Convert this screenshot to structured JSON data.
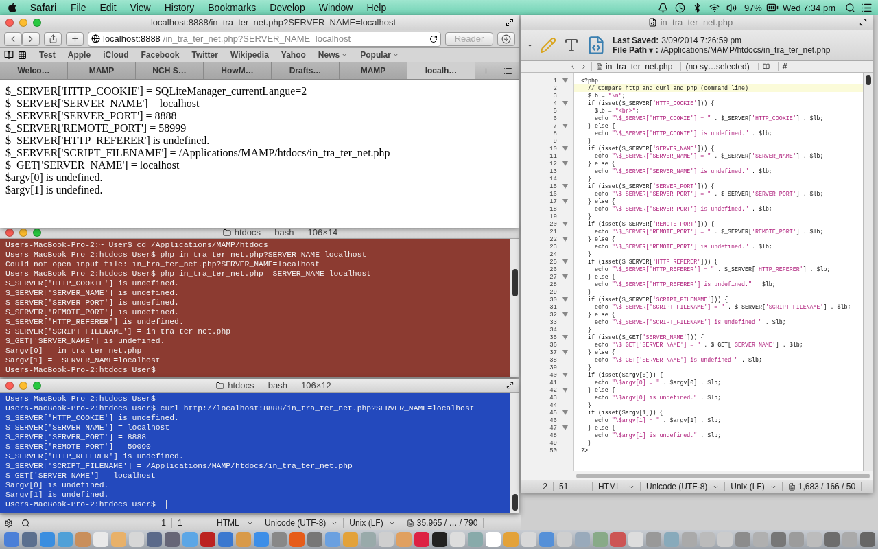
{
  "menubar": {
    "app": "Safari",
    "menus": [
      "File",
      "Edit",
      "View",
      "History",
      "Bookmarks",
      "Develop",
      "Window",
      "Help"
    ],
    "battery": "97%",
    "clock": "Wed 7:34 pm"
  },
  "browser": {
    "title": "localhost:8888/in_tra_ter_net.php?SERVER_NAME=localhost",
    "address_host": "localhost:8888",
    "address_path": "/in_tra_ter_net.php?SERVER_NAME=localhost",
    "reader": "Reader",
    "bookmarks": [
      {
        "label": "Test",
        "menu": false
      },
      {
        "label": "Apple",
        "menu": false
      },
      {
        "label": "iCloud",
        "menu": false
      },
      {
        "label": "Facebook",
        "menu": false
      },
      {
        "label": "Twitter",
        "menu": false
      },
      {
        "label": "Wikipedia",
        "menu": false
      },
      {
        "label": "Yahoo",
        "menu": false
      },
      {
        "label": "News",
        "menu": true
      },
      {
        "label": "Popular",
        "menu": true
      }
    ],
    "tabs": [
      {
        "label": "Welco…",
        "selected": false
      },
      {
        "label": "MAMP",
        "selected": false
      },
      {
        "label": "NCH S…",
        "selected": false
      },
      {
        "label": "HowM…",
        "selected": false
      },
      {
        "label": "Drafts…",
        "selected": false
      },
      {
        "label": "MAMP",
        "selected": false
      },
      {
        "label": "localh…",
        "selected": true
      }
    ],
    "content": [
      "$_SERVER['HTTP_COOKIE'] = SQLiteManager_currentLangue=2",
      "$_SERVER['SERVER_NAME'] = localhost",
      "$_SERVER['SERVER_PORT'] = 8888",
      "$_SERVER['REMOTE_PORT'] = 58999",
      "$_SERVER['HTTP_REFERER'] is undefined.",
      "$_SERVER['SCRIPT_FILENAME'] = /Applications/MAMP/htdocs/in_tra_ter_net.php",
      "$_GET['SERVER_NAME'] = localhost",
      "$argv[0] is undefined.",
      "$argv[1] is undefined."
    ]
  },
  "terminals": [
    {
      "title": "htdocs — bash — 106×14",
      "color": "#8c3b31",
      "cursor": false,
      "lines": [
        "Users-MacBook-Pro-2:~ User$ cd /Applications/MAMP/htdocs",
        "Users-MacBook-Pro-2:htdocs User$ php in_tra_ter_net.php?SERVER_NAME=localhost",
        "Could not open input file: in_tra_ter_net.php?SERVER_NAME=localhost",
        "Users-MacBook-Pro-2:htdocs User$ php in_tra_ter_net.php  SERVER_NAME=localhost",
        "$_SERVER['HTTP_COOKIE'] is undefined.",
        "$_SERVER['SERVER_NAME'] is undefined.",
        "$_SERVER['SERVER_PORT'] is undefined.",
        "$_SERVER['REMOTE_PORT'] is undefined.",
        "$_SERVER['HTTP_REFERER'] is undefined.",
        "$_SERVER['SCRIPT_FILENAME'] = in_tra_ter_net.php",
        "$_GET['SERVER_NAME'] is undefined.",
        "$argv[0] = in_tra_ter_net.php",
        "$argv[1] =  SERVER_NAME=localhost",
        "Users-MacBook-Pro-2:htdocs User$"
      ]
    },
    {
      "title": "htdocs — bash — 106×12",
      "color": "#2349bd",
      "cursor": true,
      "lines": [
        "Users-MacBook-Pro-2:htdocs User$",
        "Users-MacBook-Pro-2:htdocs User$ curl http://localhost:8888/in_tra_ter_net.php?SERVER_NAME=localhost",
        "$_SERVER['HTTP_COOKIE'] is undefined.",
        "$_SERVER['SERVER_NAME'] = localhost",
        "$_SERVER['SERVER_PORT'] = 8888",
        "$_SERVER['REMOTE_PORT'] = 59090",
        "$_SERVER['HTTP_REFERER'] is undefined.",
        "$_SERVER['SCRIPT_FILENAME'] = /Applications/MAMP/htdocs/in_tra_ter_net.php",
        "$_GET['SERVER_NAME'] = localhost",
        "$argv[0] is undefined.",
        "$argv[1] is undefined.",
        "Users-MacBook-Pro-2:htdocs User$"
      ]
    }
  ],
  "editor": {
    "title": "in_tra_ter_net.php",
    "last_saved_label": "Last Saved:",
    "last_saved": "3/09/2014 7:26:59 pm",
    "file_path_label": "File Path ▾ :",
    "file_path": "/Applications/MAMP/htdocs/in_tra_ter_net.php",
    "nav_file": "in_tra_ter_net.php",
    "nav_symbol": "(no sy…selected)",
    "nav_hash": "#",
    "lines": [
      {
        "n": "1",
        "text": "<?php",
        "fold": true,
        "current": false
      },
      {
        "n": "2",
        "text": "  // Compare http and curl and php (command line)",
        "fold": false,
        "current": true
      },
      {
        "n": "3",
        "text": "  $lb = \"\\n\";",
        "fold": false,
        "current": false
      },
      {
        "n": "4",
        "text": "  if (isset($_SERVER['HTTP_COOKIE'])) {",
        "fold": true,
        "current": false
      },
      {
        "n": "5",
        "text": "    $lb = \"<br>\";",
        "fold": false,
        "current": false
      },
      {
        "n": "6",
        "text": "    echo \"\\$_SERVER['HTTP_COOKIE'] = \" . $_SERVER['HTTP_COOKIE'] . $lb;",
        "fold": false,
        "current": false
      },
      {
        "n": "7",
        "text": "  } else {",
        "fold": true,
        "current": false
      },
      {
        "n": "8",
        "text": "    echo \"\\$_SERVER['HTTP_COOKIE'] is undefined.\" . $lb;",
        "fold": false,
        "current": false
      },
      {
        "n": "9",
        "text": "  }",
        "fold": false,
        "current": false
      },
      {
        "n": "10",
        "text": "  if (isset($_SERVER['SERVER_NAME'])) {",
        "fold": true,
        "current": false
      },
      {
        "n": "11",
        "text": "    echo \"\\$_SERVER['SERVER_NAME'] = \" . $_SERVER['SERVER_NAME'] . $lb;",
        "fold": false,
        "current": false
      },
      {
        "n": "12",
        "text": "  } else {",
        "fold": true,
        "current": false
      },
      {
        "n": "13",
        "text": "    echo \"\\$_SERVER['SERVER_NAME'] is undefined.\" . $lb;",
        "fold": false,
        "current": false
      },
      {
        "n": "14",
        "text": "  }",
        "fold": false,
        "current": false
      },
      {
        "n": "15",
        "text": "  if (isset($_SERVER['SERVER_PORT'])) {",
        "fold": true,
        "current": false
      },
      {
        "n": "16",
        "text": "    echo \"\\$_SERVER['SERVER_PORT'] = \" . $_SERVER['SERVER_PORT'] . $lb;",
        "fold": false,
        "current": false
      },
      {
        "n": "17",
        "text": "  } else {",
        "fold": true,
        "current": false
      },
      {
        "n": "18",
        "text": "    echo \"\\$_SERVER['SERVER_PORT'] is undefined.\" . $lb;",
        "fold": false,
        "current": false
      },
      {
        "n": "19",
        "text": "  }",
        "fold": false,
        "current": false
      },
      {
        "n": "20",
        "text": "  if (isset($_SERVER['REMOTE_PORT'])) {",
        "fold": true,
        "current": false
      },
      {
        "n": "21",
        "text": "    echo \"\\$_SERVER['REMOTE_PORT'] = \" . $_SERVER['REMOTE_PORT'] . $lb;",
        "fold": false,
        "current": false
      },
      {
        "n": "22",
        "text": "  } else {",
        "fold": true,
        "current": false
      },
      {
        "n": "23",
        "text": "    echo \"\\$_SERVER['REMOTE_PORT'] is undefined.\" . $lb;",
        "fold": false,
        "current": false
      },
      {
        "n": "24",
        "text": "  }",
        "fold": false,
        "current": false
      },
      {
        "n": "25",
        "text": "  if (isset($_SERVER['HTTP_REFERER'])) {",
        "fold": true,
        "current": false
      },
      {
        "n": "26",
        "text": "    echo \"\\$_SERVER['HTTP_REFERER'] = \" . $_SERVER['HTTP_REFERER'] . $lb;",
        "fold": false,
        "current": false
      },
      {
        "n": "27",
        "text": "  } else {",
        "fold": true,
        "current": false
      },
      {
        "n": "28",
        "text": "    echo \"\\$_SERVER['HTTP_REFERER'] is undefined.\" . $lb;",
        "fold": false,
        "current": false
      },
      {
        "n": "29",
        "text": "  }",
        "fold": false,
        "current": false
      },
      {
        "n": "30",
        "text": "  if (isset($_SERVER['SCRIPT_FILENAME'])) {",
        "fold": true,
        "current": false
      },
      {
        "n": "31",
        "text": "    echo \"\\$_SERVER['SCRIPT_FILENAME'] = \" . $_SERVER['SCRIPT_FILENAME'] . $lb;",
        "fold": false,
        "current": false
      },
      {
        "n": "32",
        "text": "  } else {",
        "fold": true,
        "current": false
      },
      {
        "n": "33",
        "text": "    echo \"\\$_SERVER['SCRIPT_FILENAME'] is undefined.\" . $lb;",
        "fold": false,
        "current": false
      },
      {
        "n": "34",
        "text": "  }",
        "fold": false,
        "current": false
      },
      {
        "n": "35",
        "text": "  if (isset($_GET['SERVER_NAME'])) {",
        "fold": true,
        "current": false
      },
      {
        "n": "36",
        "text": "    echo \"\\$_GET['SERVER_NAME'] = \" . $_GET['SERVER_NAME'] . $lb;",
        "fold": false,
        "current": false
      },
      {
        "n": "37",
        "text": "  } else {",
        "fold": true,
        "current": false
      },
      {
        "n": "38",
        "text": "    echo \"\\$_GET['SERVER_NAME'] is undefined.\" . $lb;",
        "fold": false,
        "current": false
      },
      {
        "n": "39",
        "text": "  }",
        "fold": false,
        "current": false
      },
      {
        "n": "40",
        "text": "  if (isset($argv[0])) {",
        "fold": true,
        "current": false
      },
      {
        "n": "41",
        "text": "    echo \"\\$argv[0] = \" . $argv[0] . $lb;",
        "fold": false,
        "current": false
      },
      {
        "n": "42",
        "text": "  } else {",
        "fold": true,
        "current": false
      },
      {
        "n": "43",
        "text": "    echo \"\\$argv[0] is undefined.\" . $lb;",
        "fold": false,
        "current": false
      },
      {
        "n": "44",
        "text": "  }",
        "fold": false,
        "current": false
      },
      {
        "n": "45",
        "text": "  if (isset($argv[1])) {",
        "fold": true,
        "current": false
      },
      {
        "n": "46",
        "text": "    echo \"\\$argv[1] = \" . $argv[1] . $lb;",
        "fold": false,
        "current": false
      },
      {
        "n": "47",
        "text": "  } else {",
        "fold": true,
        "current": false
      },
      {
        "n": "48",
        "text": "    echo \"\\$argv[1] is undefined.\" . $lb;",
        "fold": false,
        "current": false
      },
      {
        "n": "49",
        "text": "  }",
        "fold": false,
        "current": false
      },
      {
        "n": "50",
        "text": "?>",
        "fold": false,
        "current": false
      }
    ],
    "status": {
      "line": "2",
      "col": "51",
      "language": "HTML",
      "encoding": "Unicode (UTF-8)",
      "line_endings": "Unix (LF)",
      "stats": "1,683 / 166 / 50"
    }
  },
  "back_status": {
    "line": "1",
    "col": "1",
    "language": "HTML",
    "encoding": "Unicode (UTF-8)",
    "line_endings": "Unix (LF)",
    "stats": "35,965 / … / 790"
  }
}
